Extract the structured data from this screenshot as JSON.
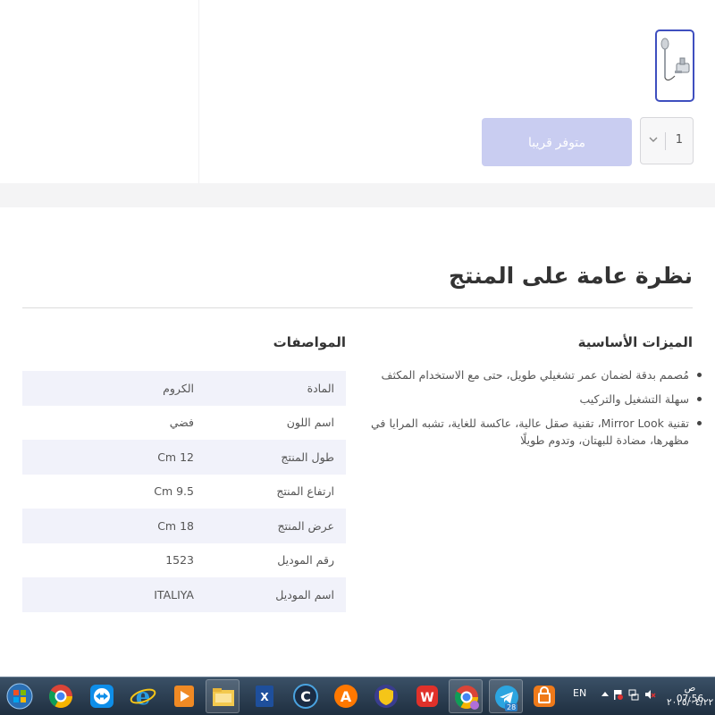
{
  "product": {
    "quantity": "1",
    "coming_soon_label": "متوفر قريبا"
  },
  "overview": {
    "title": "نظرة عامة على المنتج",
    "features_title": "الميزات الأساسية",
    "features": [
      "مُصمم بدقة لضمان عمر تشغيلي طويل، حتى مع الاستخدام المكثف",
      "سهلة التشغيل والتركيب",
      "تقنية Mirror Look، تقنية صقل عالية، عاكسة للغاية، تشبه المرايا في مظهرها، مضادة للبهتان، وتدوم طويلًا"
    ],
    "specs_title": "المواصفات",
    "specs": [
      {
        "label": "المادة",
        "value": "الكروم"
      },
      {
        "label": "اسم اللون",
        "value": "فضي"
      },
      {
        "label": "طول المنتج",
        "value": "12 Cm"
      },
      {
        "label": "ارتفاع المنتج",
        "value": "9.5 Cm"
      },
      {
        "label": "عرض المنتج",
        "value": "18 Cm"
      },
      {
        "label": "رقم الموديل",
        "value": "1523"
      },
      {
        "label": "اسم الموديل",
        "value": "ITALIYA"
      }
    ]
  },
  "taskbar": {
    "language": "EN",
    "time": "ص 07:56",
    "date": "٢٠٢٥/٠٤/٢٢",
    "telegram_badge": "28",
    "apps": [
      "start-orb",
      "chrome-icon",
      "teamviewer-icon",
      "ie-icon",
      "media-player-icon",
      "file-explorer-icon",
      "excel-icon",
      "ccleaner-icon",
      "avast-icon",
      "vpn-icon",
      "wps-icon",
      "chrome-profile-icon",
      "telegram-icon",
      "cashier-icon"
    ]
  },
  "colors": {
    "accent": "#3f4fbf",
    "button_disabled": "#c9cdf1",
    "row_alt": "#f1f2fa"
  }
}
